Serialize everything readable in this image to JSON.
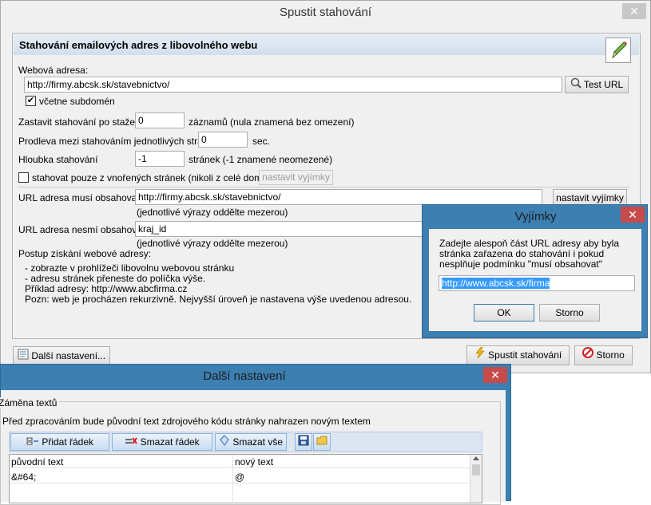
{
  "main_window": {
    "title": "Spustit stahování",
    "header": "Stahování emailových adres z libovolného webu",
    "web_address_label": "Webová adresa:",
    "web_address_value": "http://firmy.abcsk.sk/stavebnictvo/",
    "test_url_button": "Test URL",
    "subdomains_checkbox_label": "včetne subdomén",
    "subdomains_checked": true,
    "stop_after_label": "Zastavit stahování po stažení",
    "stop_after_value": "0",
    "stop_after_suffix": "záznamů (nula znamená bez omezení)",
    "delay_label": "Prodleva mezi stahováním jednotlivých stránek",
    "delay_value": "0",
    "delay_suffix": "sec.",
    "depth_label": "Hloubka stahování",
    "depth_value": "-1",
    "depth_suffix": "stránek (-1 znamené neomezené)",
    "nested_checkbox_label": "stahovat pouze z vnořených stránek (nikoli z celé domény)",
    "nested_checked": false,
    "set_exceptions_disabled": "nastavit vyjímky",
    "url_must_label": "URL adresa musí obsahovat:",
    "url_must_value": "http://firmy.abcsk.sk/stavebnictvo/",
    "url_must_hint": "(jednotlivé výrazy oddělte mezerou)",
    "set_exceptions_button": "nastavit vyjímky",
    "url_mustnot_label": "URL adresa nesmí obsahovat:",
    "url_mustnot_value": "kraj_id",
    "url_mustnot_hint": "(jednotlivé výrazy oddělte mezerou)",
    "procedure_title": "Postup získání webové adresy:",
    "procedure_lines": [
      "- zobrazte v prohlížeči libovolnu webovou stránku",
      "- adresu stránek přeneste do políčka výše.",
      "Příklad adresy: http://www.abcfirma.cz",
      "Pozn: web je procházen rekurzivně. Nejvyšší úroveň je nastavena výše uvedenou adresou."
    ],
    "more_settings_button": "Další nastavení...",
    "start_button": "Spustit stahování",
    "cancel_button": "Storno"
  },
  "exceptions_dialog": {
    "title": "Vyjímky",
    "description": "Zadejte alespoň část URL adresy aby byla stránka zařazena do stahování i pokud nesplňuje podmínku \"musí obsahovat\"",
    "value": "http://www.abcsk.sk/firma",
    "ok_button": "OK",
    "cancel_button": "Storno"
  },
  "more_settings_window": {
    "title": "Další nastavení",
    "group_label": "Záměna textů",
    "description": "Před zpracováním bude původní text zdrojového kódu stránky nahrazen novým textem",
    "add_row_button": "Přidat řádek",
    "delete_row_button": "Smazat řádek",
    "delete_all_button": "Smazat vše",
    "columns": [
      "původní text",
      "nový text"
    ],
    "rows": [
      [
        "&#64;",
        "@"
      ]
    ]
  },
  "colors": {
    "accent_blue": "#3c7fb1",
    "close_red": "#c74b4b",
    "header_bg": "#dce6f2"
  }
}
